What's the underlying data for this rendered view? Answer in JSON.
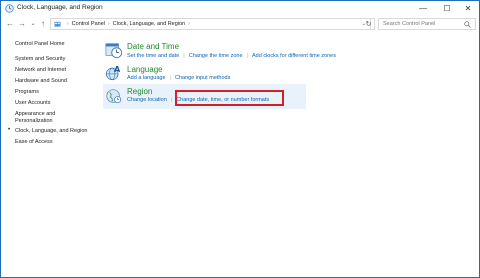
{
  "window": {
    "title": "Clock, Language, and Region",
    "controls": {
      "minimize": "—",
      "maximize": "☐",
      "close": "✕"
    }
  },
  "nav": {
    "back": "←",
    "forward": "→",
    "recent": "⌄",
    "up": "↑",
    "breadcrumb": [
      "Control Panel",
      "Clock, Language, and Region"
    ],
    "breadcrumb_sep": "›",
    "dropdown": "⌄",
    "refresh": "↻",
    "search_placeholder": "Search Control Panel"
  },
  "sidebar": {
    "items": [
      {
        "label": "Control Panel Home"
      },
      {
        "label": "System and Security"
      },
      {
        "label": "Network and Internet"
      },
      {
        "label": "Hardware and Sound"
      },
      {
        "label": "Programs"
      },
      {
        "label": "User Accounts"
      },
      {
        "label": "Appearance and Personalization"
      },
      {
        "label": "Clock, Language, and Region",
        "current": true
      },
      {
        "label": "Ease of Access"
      }
    ],
    "appearance_line1": "Appearance and",
    "appearance_line2": "Personalization",
    "bullet": "•"
  },
  "categories": [
    {
      "title": "Date and Time",
      "icon": "clock-icon",
      "links": [
        "Set the time and date",
        "Change the time zone",
        "Add clocks for different time zones"
      ]
    },
    {
      "title": "Language",
      "icon": "language-icon",
      "links": [
        "Add a language",
        "Change input methods"
      ]
    },
    {
      "title": "Region",
      "icon": "globe-icon",
      "links": [
        "Change location",
        "Change date, time, or number formats"
      ]
    }
  ],
  "colors": {
    "category_title": "#1e8a2b",
    "link": "#0b63b6",
    "highlight": "#d0212b",
    "selection_bg": "#e9f2fb"
  }
}
